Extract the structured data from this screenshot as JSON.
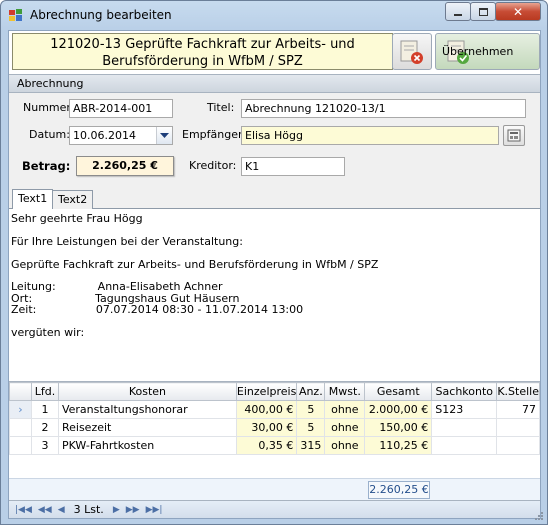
{
  "window": {
    "title": "Abrechnung bearbeiten"
  },
  "header": {
    "title": "121020-13 Geprüfte Fachkraft zur Arbeits- und Berufsförderung in WfbM / SPZ",
    "ok_label": "Übernehmen"
  },
  "section": {
    "label": "Abrechnung"
  },
  "form": {
    "nummer_label": "Nummer:",
    "nummer_value": "ABR-2014-001",
    "titel_label": "Titel:",
    "titel_value": "Abrechnung 121020-13/1",
    "datum_label": "Datum:",
    "datum_value": "10.06.2014",
    "empfaenger_label": "Empfänger:",
    "empfaenger_value": "Elisa Högg",
    "betrag_label": "Betrag:",
    "betrag_value": "2.260,25 €",
    "kreditor_label": "Kreditor:",
    "kreditor_value": "K1"
  },
  "tabs": [
    "Text1",
    "Text2"
  ],
  "text": [
    "Sehr geehrte Frau Högg",
    "",
    "Für Ihre Leistungen bei der Veranstaltung:",
    "",
    "Geprüfte Fachkraft zur Arbeits- und Berufsförderung in WfbM / SPZ",
    "",
    "Leitung:            Anna-Elisabeth Achner",
    "Ort:                  Tagungshaus Gut Häusern",
    "Zeit:                 07.07.2014 08:30 - 11.07.2014 13:00",
    "",
    "vergüten wir:"
  ],
  "grid": {
    "columns": [
      "Lfd.",
      "Kosten",
      "Einzelpreis",
      "Anz.",
      "Mwst.",
      "Gesamt",
      "Sachkonto",
      "K.Stelle"
    ],
    "rows": [
      {
        "lfd": "1",
        "kosten": "Veranstaltungshonorar",
        "einzelpreis": "400,00 €",
        "anz": "5",
        "mwst": "ohne",
        "gesamt": "2.000,00 €",
        "sachkonto": "S123",
        "kstelle": "77"
      },
      {
        "lfd": "2",
        "kosten": "Reisezeit",
        "einzelpreis": "30,00 €",
        "anz": "5",
        "mwst": "ohne",
        "gesamt": "150,00 €",
        "sachkonto": "",
        "kstelle": ""
      },
      {
        "lfd": "3",
        "kosten": "PKW-Fahrtkosten",
        "einzelpreis": "0,35 €",
        "anz": "315",
        "mwst": "ohne",
        "gesamt": "110,25 €",
        "sachkonto": "",
        "kstelle": ""
      }
    ],
    "total": "2.260,25 €",
    "record_count": "3 Lst."
  }
}
